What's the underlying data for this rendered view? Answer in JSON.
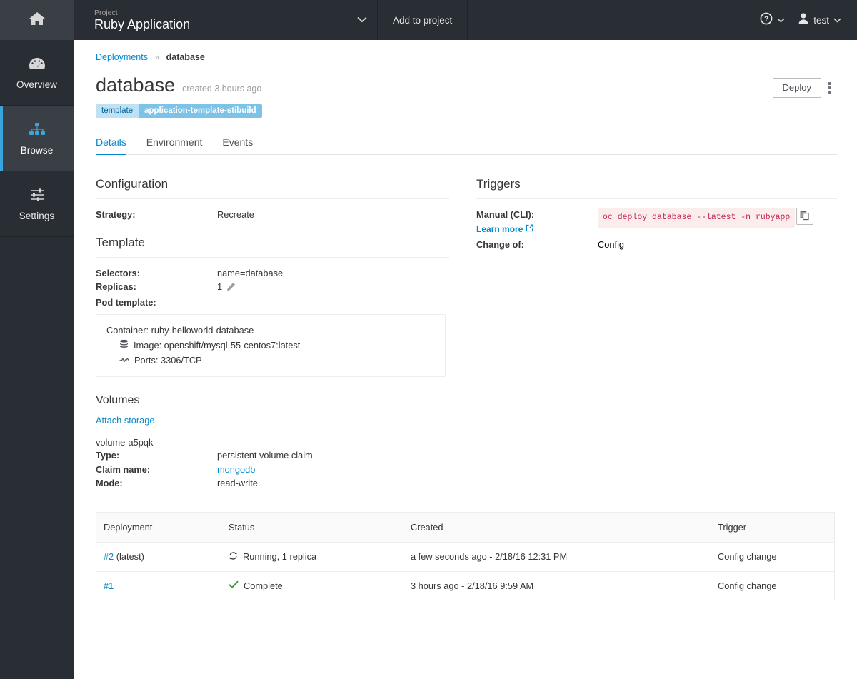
{
  "leftnav": {
    "home_icon": "home-icon",
    "items": [
      {
        "label": "Overview",
        "icon": "dashboard-icon",
        "active": false
      },
      {
        "label": "Browse",
        "icon": "sitemap-icon",
        "active": true
      },
      {
        "label": "Settings",
        "icon": "sliders-icon",
        "active": false
      }
    ]
  },
  "topbar": {
    "project_kicker": "Project",
    "project_name": "Ruby Application",
    "project_caret_icon": "chevron-down-icon",
    "add_to_project": "Add to project",
    "help_icon": "help-circle-icon",
    "help_caret_icon": "chevron-down-icon",
    "user_icon": "user-icon",
    "user_name": "test",
    "user_caret_icon": "chevron-down-icon"
  },
  "breadcrumb": {
    "parent": "Deployments",
    "separator": "»",
    "current": "database"
  },
  "page": {
    "title": "database",
    "subtitle": "created 3 hours ago",
    "label_key": "template",
    "label_value": "application-template-stibuild",
    "deploy_button": "Deploy",
    "kebab_icon": "kebab-menu-icon"
  },
  "tabs": [
    {
      "label": "Details",
      "active": true
    },
    {
      "label": "Environment",
      "active": false
    },
    {
      "label": "Events",
      "active": false
    }
  ],
  "configuration": {
    "section_title": "Configuration",
    "strategy_label": "Strategy:",
    "strategy_value": "Recreate"
  },
  "template": {
    "section_title": "Template",
    "selectors_label": "Selectors:",
    "selectors_value": "name=database",
    "replicas_label": "Replicas:",
    "replicas_value": "1",
    "replicas_edit_icon": "pencil-icon",
    "pod_template_label": "Pod template:",
    "container_line": "Container: ruby-helloworld-database",
    "image_icon": "database-stack-icon",
    "image_line": "Image: openshift/mysql-55-centos7:latest",
    "ports_icon": "pulse-icon",
    "ports_line": "Ports: 3306/TCP"
  },
  "volumes": {
    "section_title": "Volumes",
    "attach_storage": "Attach storage",
    "volume_name": "volume-a5pqk",
    "type_label": "Type:",
    "type_value": "persistent volume claim",
    "claim_label": "Claim name:",
    "claim_value": "mongodb",
    "mode_label": "Mode:",
    "mode_value": "read-write"
  },
  "triggers": {
    "section_title": "Triggers",
    "manual_label": "Manual (CLI):",
    "manual_command": "oc deploy database --latest -n rubyapp",
    "copy_icon": "copy-icon",
    "learn_more": "Learn more",
    "learn_more_icon": "external-link-icon",
    "change_label": "Change of:",
    "change_value": "Config"
  },
  "deployments_table": {
    "columns": [
      "Deployment",
      "Status",
      "Created",
      "Trigger"
    ],
    "rows": [
      {
        "name": "#2",
        "name_suffix": " (latest)",
        "status_icon": "sync-icon",
        "status": "Running, 1 replica",
        "created": "a few seconds ago - 2/18/16 12:31 PM",
        "trigger": "Config change"
      },
      {
        "name": "#1",
        "name_suffix": "",
        "status_icon": "check-icon",
        "status": "Complete",
        "created": "3 hours ago - 2/18/16 9:59 AM",
        "trigger": "Config change"
      }
    ]
  },
  "colors": {
    "nav_bg": "#292e34",
    "nav_active": "#393f44",
    "accent_blue": "#0088ce",
    "active_bar": "#39a5dc",
    "label_key_bg": "#bee1f4",
    "label_val_bg": "#7dc3e8",
    "code_text": "#c7254e",
    "code_bg": "#fceded",
    "success_green": "#3f9c35"
  }
}
